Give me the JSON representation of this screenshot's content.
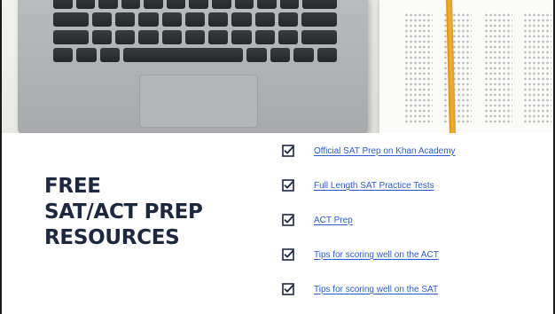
{
  "heading": {
    "line1": "FREE",
    "line2": "SAT/ACT PREP",
    "line3": "RESOURCES"
  },
  "links": [
    {
      "label": "Official SAT Prep on Khan Academy",
      "icon": "checkbox-checked-icon"
    },
    {
      "label": "Full Length SAT Practice Tests",
      "icon": "checkbox-checked-icon"
    },
    {
      "label": "ACT Prep",
      "icon": "checkbox-checked-icon"
    },
    {
      "label": "Tips for scoring well on the ACT",
      "icon": "checkbox-checked-icon"
    },
    {
      "label": "Tips for scoring well on the SAT",
      "icon": "checkbox-checked-icon"
    }
  ],
  "colors": {
    "heading": "#1c2740",
    "link": "#2a5bd7",
    "checkbox": "#1c2740"
  }
}
